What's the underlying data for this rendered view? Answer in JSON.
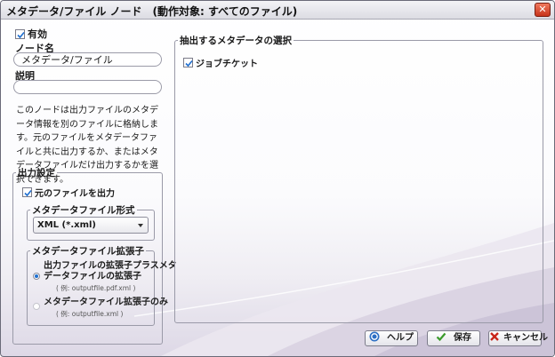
{
  "window": {
    "title": "メタデータ/ファイル ノード　(動作対象: すべてのファイル)",
    "close_glyph": "✕"
  },
  "left": {
    "enabled_label": "有効",
    "enabled_checked": true,
    "node_name_label": "ノード名",
    "node_name_value": "メタデータ/ファイル",
    "description_label": "説明",
    "description_value": "",
    "help_text": "このノードは出力ファイルのメタデータ情報を別のファイルに格納します。元のファイルをメタデータファイルと共に出力するか、またはメタデータファイルだけ出力するかを選択できます。",
    "output_settings": {
      "legend": "出力設定",
      "output_original_label": "元のファイルを出力",
      "output_original_checked": true,
      "format": {
        "legend": "メタデータファイル形式",
        "selected": "XML (*.xml)"
      },
      "extension": {
        "legend": "メタデータファイル拡張子",
        "option1_line1": "出力ファイルの拡張子プラスメタ",
        "option1_line2": "データファイルの拡張子",
        "option1_example": "( 例: outputfile.pdf.xml )",
        "option2_label": "メタデータファイル拡張子のみ",
        "option2_example": "( 例: outputfile.xml )",
        "selected_option": 1
      }
    }
  },
  "right": {
    "legend": "抽出するメタデータの選択",
    "items": [
      {
        "label": "ジョブチケット",
        "checked": true
      }
    ]
  },
  "buttons": {
    "help": "ヘルプ",
    "save": "保存",
    "cancel": "キャンセル"
  },
  "colors": {
    "accent_blue": "#1f6fd0",
    "save_green": "#3a9a2a",
    "cancel_red": "#c8251a",
    "close_red": "#c6341b"
  },
  "icons": {
    "help": "question-circle-icon",
    "save": "checkmark-icon",
    "cancel": "x-icon",
    "close": "close-icon"
  }
}
